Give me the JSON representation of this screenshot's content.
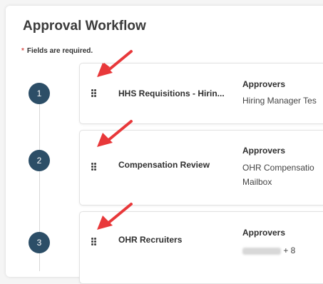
{
  "title": "Approval Workflow",
  "required_marker": "*",
  "required_note": "Fields are required.",
  "approvers_label": "Approvers",
  "steps": [
    {
      "number": "1",
      "name": "HHS Requisitions - Hirin...",
      "approvers_line1": "Hiring Manager Tes",
      "approvers_line2": ""
    },
    {
      "number": "2",
      "name": "Compensation Review",
      "approvers_line1": "OHR Compensatio",
      "approvers_line2": "Mailbox"
    },
    {
      "number": "3",
      "name": "OHR Recruiters",
      "approvers_line1": "",
      "approvers_extra": "+ 8"
    }
  ],
  "colors": {
    "step_circle": "#2c4e67",
    "annotation_arrow": "#e8383a",
    "required_star": "#d9534f"
  }
}
